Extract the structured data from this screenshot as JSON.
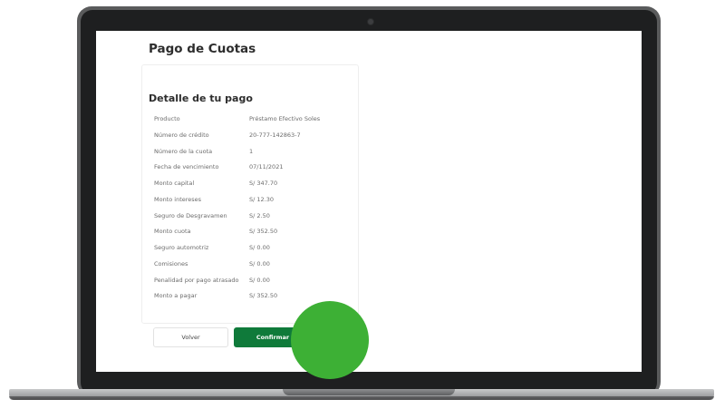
{
  "page": {
    "title": "Pago de Cuotas",
    "section_title": "Detalle de tu pago"
  },
  "details": [
    {
      "label": "Producto",
      "value": "Préstamo Efectivo Soles"
    },
    {
      "label": "Número de crédito",
      "value": "20-777-142863-7"
    },
    {
      "label": "Número de la cuota",
      "value": "1"
    },
    {
      "label": "Fecha de vencimiento",
      "value": "07/11/2021"
    },
    {
      "label": "Monto capital",
      "value": "S/ 347.70"
    },
    {
      "label": "Monto intereses",
      "value": "S/ 12.30"
    },
    {
      "label": "Seguro de Desgravamen",
      "value": "S/ 2.50"
    },
    {
      "label": "Monto cuota",
      "value": "S/ 352.50"
    },
    {
      "label": "Seguro automotriz",
      "value": "S/ 0.00"
    },
    {
      "label": "Comisiones",
      "value": "S/ 0.00"
    },
    {
      "label": "Penalidad por pago atrasado",
      "value": "S/ 0.00"
    },
    {
      "label": "Monto a pagar",
      "value": "S/ 352.50"
    }
  ],
  "buttons": {
    "back_label": "Volver",
    "confirm_label": "Confirmar"
  },
  "colors": {
    "brand_green": "#0f7a3a",
    "touch_indicator": "#3db035"
  }
}
